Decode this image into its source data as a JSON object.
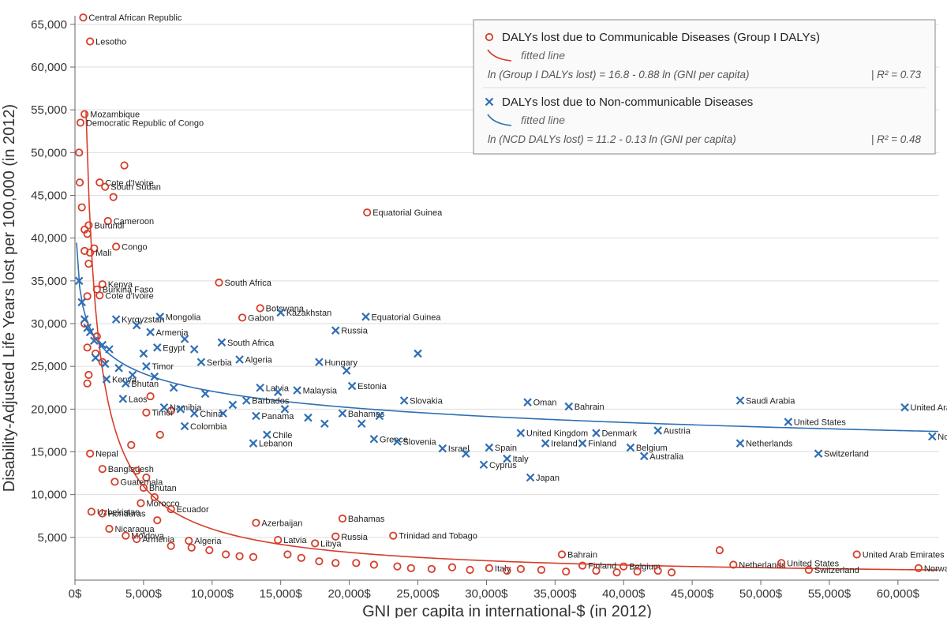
{
  "chart_data": {
    "type": "scatter",
    "xlabel": "GNI per capita in international-$ (in 2012)",
    "ylabel": "Disability-Adjusted Life Years lost per 100,000 (in 2012)",
    "xlim": [
      0,
      63000
    ],
    "ylim": [
      0,
      66000
    ],
    "xticks": [
      0,
      5000,
      10000,
      15000,
      20000,
      25000,
      30000,
      35000,
      40000,
      45000,
      50000,
      55000,
      60000
    ],
    "yticks": [
      5000,
      10000,
      15000,
      20000,
      25000,
      30000,
      35000,
      40000,
      45000,
      50000,
      55000,
      60000,
      65000
    ],
    "xtick_labels": [
      "0$",
      "5,000$",
      "10,000$",
      "15,000$",
      "20,000$",
      "25,000$",
      "30,000$",
      "35,000$",
      "40,000$",
      "45,000$",
      "50,000$",
      "55,000$",
      "60,000$"
    ],
    "ytick_labels": [
      "5,000",
      "10,000",
      "15,000",
      "20,000",
      "25,000",
      "30,000",
      "35,000",
      "40,000",
      "45,000",
      "50,000",
      "55,000",
      "60,000",
      "65,000"
    ],
    "legend": {
      "series1": {
        "title": "DALYs lost due to Communicable Diseases (Group I DALYs)",
        "sub": "fitted line",
        "eq": "ln (Group I DALYs lost) = 16.8 - 0.88 ln (GNI per capita)",
        "r2": "R² = 0.73",
        "color": "#d53e2a"
      },
      "series2": {
        "title": "DALYs lost due to Non-communicable Diseases",
        "sub": "fitted line",
        "eq": "ln (NCD DALYs lost) = 11.2 - 0.13 ln (GNI per capita)",
        "r2": "R² = 0.48",
        "color": "#2f6fb3"
      }
    },
    "fit1": {
      "a": 16.8,
      "b": -0.88
    },
    "fit2": {
      "a": 11.2,
      "b": -0.13
    },
    "series": [
      {
        "name": "communicable",
        "marker": "o",
        "color": "#d53e2a",
        "points": [
          {
            "x": 600,
            "y": 65800,
            "label": "Central African Republic"
          },
          {
            "x": 1100,
            "y": 63000,
            "label": "Lesotho"
          },
          {
            "x": 700,
            "y": 54500,
            "label": "Mozambique"
          },
          {
            "x": 400,
            "y": 53500,
            "label": "Democratic Republic of Congo"
          },
          {
            "x": 3600,
            "y": 48500,
            "label": ""
          },
          {
            "x": 1800,
            "y": 46500,
            "label": "Cote d'Ivoire"
          },
          {
            "x": 2200,
            "y": 46000,
            "label": "South Sudan"
          },
          {
            "x": 2800,
            "y": 44800,
            "label": ""
          },
          {
            "x": 500,
            "y": 43600,
            "label": ""
          },
          {
            "x": 21300,
            "y": 43000,
            "label": "Equatorial Guinea"
          },
          {
            "x": 2400,
            "y": 42000,
            "label": "Cameroon"
          },
          {
            "x": 1000,
            "y": 41500,
            "label": "Burundi"
          },
          {
            "x": 700,
            "y": 41000,
            "label": ""
          },
          {
            "x": 900,
            "y": 40500,
            "label": ""
          },
          {
            "x": 3000,
            "y": 39000,
            "label": "Congo"
          },
          {
            "x": 1400,
            "y": 38800,
            "label": ""
          },
          {
            "x": 700,
            "y": 38500,
            "label": ""
          },
          {
            "x": 1100,
            "y": 38300,
            "label": "Mali"
          },
          {
            "x": 1000,
            "y": 37000,
            "label": ""
          },
          {
            "x": 2000,
            "y": 34600,
            "label": "Kenya"
          },
          {
            "x": 10500,
            "y": 34800,
            "label": "South Africa"
          },
          {
            "x": 1600,
            "y": 34000,
            "label": "Burkina Faso"
          },
          {
            "x": 1800,
            "y": 33300,
            "label": "Cote d'Ivoire"
          },
          {
            "x": 900,
            "y": 33200,
            "label": ""
          },
          {
            "x": 13500,
            "y": 31800,
            "label": "Botswana"
          },
          {
            "x": 12200,
            "y": 30700,
            "label": "Gabon"
          },
          {
            "x": 700,
            "y": 30000,
            "label": ""
          },
          {
            "x": 1600,
            "y": 28500,
            "label": ""
          },
          {
            "x": 900,
            "y": 27200,
            "label": ""
          },
          {
            "x": 1500,
            "y": 26500,
            "label": ""
          },
          {
            "x": 2000,
            "y": 25500,
            "label": ""
          },
          {
            "x": 1000,
            "y": 24000,
            "label": ""
          },
          {
            "x": 900,
            "y": 23000,
            "label": ""
          },
          {
            "x": 5500,
            "y": 21500,
            "label": ""
          },
          {
            "x": 7000,
            "y": 19800,
            "label": ""
          },
          {
            "x": 5200,
            "y": 19600,
            "label": "Timor"
          },
          {
            "x": 6200,
            "y": 17000,
            "label": ""
          },
          {
            "x": 4100,
            "y": 15800,
            "label": ""
          },
          {
            "x": 1100,
            "y": 14800,
            "label": "Nepal"
          },
          {
            "x": 2000,
            "y": 13000,
            "label": "Bangladesh"
          },
          {
            "x": 4500,
            "y": 12800,
            "label": ""
          },
          {
            "x": 5200,
            "y": 12000,
            "label": ""
          },
          {
            "x": 2900,
            "y": 11500,
            "label": "Guatemala"
          },
          {
            "x": 5000,
            "y": 10800,
            "label": "Bhutan"
          },
          {
            "x": 5800,
            "y": 9700,
            "label": ""
          },
          {
            "x": 4800,
            "y": 9000,
            "label": "Morocco"
          },
          {
            "x": 1200,
            "y": 8000,
            "label": "Uzbekistan"
          },
          {
            "x": 2000,
            "y": 7800,
            "label": "Honduras"
          },
          {
            "x": 7000,
            "y": 8300,
            "label": "Ecuador"
          },
          {
            "x": 6000,
            "y": 7000,
            "label": ""
          },
          {
            "x": 13200,
            "y": 6700,
            "label": "Azerbaijan"
          },
          {
            "x": 19500,
            "y": 7200,
            "label": "Bahamas"
          },
          {
            "x": 2500,
            "y": 6000,
            "label": "Nicaragua"
          },
          {
            "x": 3700,
            "y": 5200,
            "label": "Moldova"
          },
          {
            "x": 4500,
            "y": 4800,
            "label": "Armenia"
          },
          {
            "x": 8300,
            "y": 4600,
            "label": "Algeria"
          },
          {
            "x": 7000,
            "y": 4000,
            "label": ""
          },
          {
            "x": 8500,
            "y": 3800,
            "label": ""
          },
          {
            "x": 9800,
            "y": 3500,
            "label": ""
          },
          {
            "x": 11000,
            "y": 3000,
            "label": ""
          },
          {
            "x": 12000,
            "y": 2800,
            "label": ""
          },
          {
            "x": 13000,
            "y": 2700,
            "label": ""
          },
          {
            "x": 14800,
            "y": 4700,
            "label": "Latvia"
          },
          {
            "x": 19000,
            "y": 5100,
            "label": "Russia"
          },
          {
            "x": 17500,
            "y": 4300,
            "label": "Libya"
          },
          {
            "x": 15500,
            "y": 3000,
            "label": ""
          },
          {
            "x": 16500,
            "y": 2600,
            "label": ""
          },
          {
            "x": 17800,
            "y": 2200,
            "label": ""
          },
          {
            "x": 19000,
            "y": 2000,
            "label": ""
          },
          {
            "x": 20500,
            "y": 2000,
            "label": ""
          },
          {
            "x": 21800,
            "y": 1800,
            "label": ""
          },
          {
            "x": 23200,
            "y": 5200,
            "label": "Trinidad and Tobago"
          },
          {
            "x": 23500,
            "y": 1600,
            "label": ""
          },
          {
            "x": 24500,
            "y": 1400,
            "label": ""
          },
          {
            "x": 26000,
            "y": 1300,
            "label": ""
          },
          {
            "x": 27500,
            "y": 1500,
            "label": ""
          },
          {
            "x": 28800,
            "y": 1200,
            "label": ""
          },
          {
            "x": 30200,
            "y": 1400,
            "label": "Italy"
          },
          {
            "x": 31500,
            "y": 1100,
            "label": ""
          },
          {
            "x": 32500,
            "y": 1300,
            "label": ""
          },
          {
            "x": 34000,
            "y": 1200,
            "label": ""
          },
          {
            "x": 35500,
            "y": 3000,
            "label": "Bahrain"
          },
          {
            "x": 35800,
            "y": 1000,
            "label": ""
          },
          {
            "x": 37000,
            "y": 1700,
            "label": "Finland"
          },
          {
            "x": 38000,
            "y": 1100,
            "label": ""
          },
          {
            "x": 40000,
            "y": 1600,
            "label": "Belgium"
          },
          {
            "x": 39500,
            "y": 900,
            "label": ""
          },
          {
            "x": 41000,
            "y": 1000,
            "label": ""
          },
          {
            "x": 42500,
            "y": 1100,
            "label": ""
          },
          {
            "x": 43500,
            "y": 900,
            "label": ""
          },
          {
            "x": 47000,
            "y": 3500,
            "label": ""
          },
          {
            "x": 48000,
            "y": 1800,
            "label": "Netherlands"
          },
          {
            "x": 51500,
            "y": 2000,
            "label": "United States"
          },
          {
            "x": 53500,
            "y": 1200,
            "label": "Switzerland"
          },
          {
            "x": 57000,
            "y": 3000,
            "label": "United Arab Emirates"
          },
          {
            "x": 61500,
            "y": 1400,
            "label": "Norway"
          },
          {
            "x": 300,
            "y": 50000,
            "label": ""
          },
          {
            "x": 350,
            "y": 46500,
            "label": ""
          }
        ]
      },
      {
        "name": "noncommunicable",
        "marker": "x",
        "color": "#2f6fb3",
        "points": [
          {
            "x": 300,
            "y": 35000,
            "label": ""
          },
          {
            "x": 500,
            "y": 32500,
            "label": ""
          },
          {
            "x": 700,
            "y": 30500,
            "label": ""
          },
          {
            "x": 900,
            "y": 29500,
            "label": ""
          },
          {
            "x": 1100,
            "y": 29000,
            "label": ""
          },
          {
            "x": 1400,
            "y": 28000,
            "label": ""
          },
          {
            "x": 2000,
            "y": 27500,
            "label": ""
          },
          {
            "x": 2500,
            "y": 27000,
            "label": ""
          },
          {
            "x": 3000,
            "y": 30500,
            "label": "Kyrgyzstan"
          },
          {
            "x": 4500,
            "y": 29800,
            "label": ""
          },
          {
            "x": 6200,
            "y": 30800,
            "label": "Mongolia"
          },
          {
            "x": 5500,
            "y": 29000,
            "label": "Armenia"
          },
          {
            "x": 6000,
            "y": 27200,
            "label": "Egypt"
          },
          {
            "x": 5000,
            "y": 26500,
            "label": ""
          },
          {
            "x": 8000,
            "y": 28200,
            "label": ""
          },
          {
            "x": 8700,
            "y": 27000,
            "label": ""
          },
          {
            "x": 9200,
            "y": 25500,
            "label": "Serbia"
          },
          {
            "x": 10700,
            "y": 27800,
            "label": "South Africa"
          },
          {
            "x": 12000,
            "y": 25800,
            "label": "Algeria"
          },
          {
            "x": 15000,
            "y": 31300,
            "label": "Kazakhstan"
          },
          {
            "x": 19000,
            "y": 29200,
            "label": "Russia"
          },
          {
            "x": 21200,
            "y": 30800,
            "label": "Equatorial Guinea"
          },
          {
            "x": 5200,
            "y": 25000,
            "label": "Timor"
          },
          {
            "x": 17800,
            "y": 25500,
            "label": "Hungary"
          },
          {
            "x": 19800,
            "y": 24500,
            "label": ""
          },
          {
            "x": 25000,
            "y": 26500,
            "label": ""
          },
          {
            "x": 2300,
            "y": 23500,
            "label": "Kenya"
          },
          {
            "x": 3700,
            "y": 23000,
            "label": "Bhutan"
          },
          {
            "x": 13500,
            "y": 22500,
            "label": "Latvia"
          },
          {
            "x": 14800,
            "y": 22000,
            "label": ""
          },
          {
            "x": 16200,
            "y": 22200,
            "label": "Malaysia"
          },
          {
            "x": 20200,
            "y": 22700,
            "label": "Estonia"
          },
          {
            "x": 24000,
            "y": 21000,
            "label": "Slovakia"
          },
          {
            "x": 3500,
            "y": 21200,
            "label": "Laos"
          },
          {
            "x": 6500,
            "y": 20200,
            "label": "Namibia"
          },
          {
            "x": 7700,
            "y": 20000,
            "label": ""
          },
          {
            "x": 8700,
            "y": 19500,
            "label": "China"
          },
          {
            "x": 12500,
            "y": 21000,
            "label": "Barbados"
          },
          {
            "x": 33000,
            "y": 20800,
            "label": "Oman"
          },
          {
            "x": 36000,
            "y": 20300,
            "label": "Bahrain"
          },
          {
            "x": 48500,
            "y": 21000,
            "label": "Saudi Arabia"
          },
          {
            "x": 60500,
            "y": 20200,
            "label": "United Arab Emirates"
          },
          {
            "x": 8000,
            "y": 18000,
            "label": "Colombia"
          },
          {
            "x": 13200,
            "y": 19200,
            "label": "Panama"
          },
          {
            "x": 19500,
            "y": 19500,
            "label": "Bahamas"
          },
          {
            "x": 52000,
            "y": 18500,
            "label": "United States"
          },
          {
            "x": 14000,
            "y": 17000,
            "label": "Chile"
          },
          {
            "x": 13000,
            "y": 16000,
            "label": "Lebanon"
          },
          {
            "x": 21800,
            "y": 16500,
            "label": "Greece"
          },
          {
            "x": 23500,
            "y": 16200,
            "label": "Slovenia"
          },
          {
            "x": 32500,
            "y": 17200,
            "label": "United Kingdom"
          },
          {
            "x": 34300,
            "y": 16000,
            "label": "Ireland"
          },
          {
            "x": 38000,
            "y": 17200,
            "label": "Denmark"
          },
          {
            "x": 42500,
            "y": 17500,
            "label": "Austria"
          },
          {
            "x": 26800,
            "y": 15400,
            "label": "Israel"
          },
          {
            "x": 28500,
            "y": 14800,
            "label": ""
          },
          {
            "x": 30200,
            "y": 15500,
            "label": "Spain"
          },
          {
            "x": 31500,
            "y": 14200,
            "label": "Italy"
          },
          {
            "x": 37000,
            "y": 16000,
            "label": "Finland"
          },
          {
            "x": 40500,
            "y": 15500,
            "label": "Belgium"
          },
          {
            "x": 48500,
            "y": 16000,
            "label": "Netherlands"
          },
          {
            "x": 41500,
            "y": 14500,
            "label": "Australia"
          },
          {
            "x": 29800,
            "y": 13500,
            "label": "Cyprus"
          },
          {
            "x": 33200,
            "y": 12000,
            "label": "Japan"
          },
          {
            "x": 54200,
            "y": 14800,
            "label": "Switzerland"
          },
          {
            "x": 62500,
            "y": 16800,
            "label": "Norway"
          },
          {
            "x": 1500,
            "y": 26000,
            "label": ""
          },
          {
            "x": 2200,
            "y": 25300,
            "label": ""
          },
          {
            "x": 3200,
            "y": 24800,
            "label": ""
          },
          {
            "x": 4200,
            "y": 24000,
            "label": ""
          },
          {
            "x": 5800,
            "y": 23800,
            "label": ""
          },
          {
            "x": 7200,
            "y": 22500,
            "label": ""
          },
          {
            "x": 9500,
            "y": 21800,
            "label": ""
          },
          {
            "x": 10800,
            "y": 19500,
            "label": ""
          },
          {
            "x": 11500,
            "y": 20500,
            "label": ""
          },
          {
            "x": 15300,
            "y": 20000,
            "label": ""
          },
          {
            "x": 17000,
            "y": 19000,
            "label": ""
          },
          {
            "x": 18200,
            "y": 18300,
            "label": ""
          },
          {
            "x": 20900,
            "y": 18300,
            "label": ""
          },
          {
            "x": 22200,
            "y": 19200,
            "label": ""
          }
        ]
      }
    ]
  }
}
